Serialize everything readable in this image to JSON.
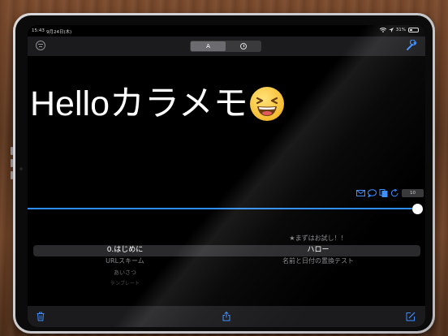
{
  "status_bar": {
    "time": "15:43",
    "date": "9月24日(木)",
    "battery": "31%"
  },
  "navbar": {
    "segments": [
      {
        "label": "A",
        "icon": "text-mode",
        "active": true
      },
      {
        "label": "",
        "icon": "clock-icon",
        "active": false
      }
    ],
    "left_icon": "list-circle-icon",
    "right_icon": "wrench-icon"
  },
  "editor": {
    "text": "Helloカラメモ",
    "emoji": "grinning-squinting-face"
  },
  "tools": {
    "icons": [
      "mail-icon",
      "chat-bubble-icon",
      "copy-icon",
      "refresh-icon"
    ],
    "count": "10"
  },
  "slider": {
    "value": 1.0
  },
  "picker": {
    "left": [
      "",
      "0.はじめに",
      "URLスキーム",
      "あいさつ",
      "テンプレート"
    ],
    "right": [
      "★まずはお試し！！",
      "ハロー",
      "名前と日付の置換テスト",
      "",
      ""
    ]
  },
  "bottom_bar": {
    "icons": [
      "trash-icon",
      "share-icon",
      "compose-icon"
    ]
  },
  "colors": {
    "accent": "#2d8cff",
    "background": "#000000",
    "bar": "#1b1b1d"
  }
}
